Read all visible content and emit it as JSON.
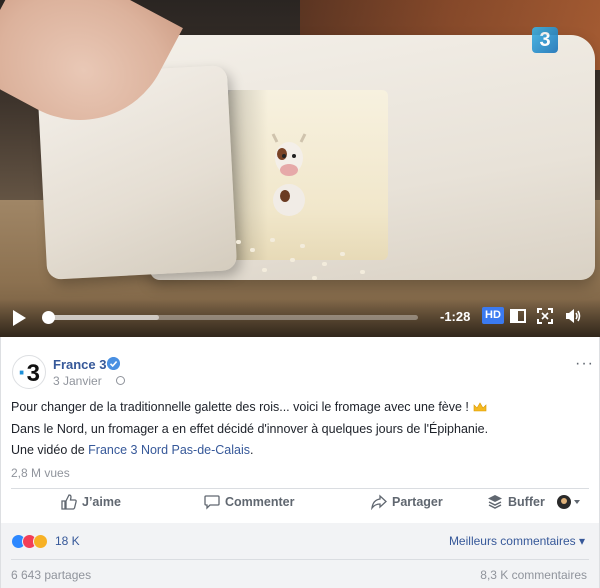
{
  "video": {
    "channel_logo": "3",
    "current_time": "-1:28",
    "hd_label": "HD",
    "progress_fraction": 0.0,
    "buffered_fraction": 0.3,
    "icons": [
      "play-icon",
      "hd-icon",
      "pip-icon",
      "fullscreen-icon",
      "volume-icon"
    ]
  },
  "post": {
    "page_name": "France 3",
    "avatar_text": "3",
    "date": "3 Janvier",
    "more_label": "···",
    "line1": "Pour changer de la traditionnelle galette des rois... voici le fromage avec une fève !",
    "line2": "Dans le Nord, un fromager a en effet décidé d'innover à quelques jours de l'Épiphanie.",
    "line3_prefix": "Une vidéo de ",
    "line3_link": "France 3 Nord Pas-de-Calais",
    "line3_suffix": ".",
    "views": "2,8 M vues"
  },
  "actions": {
    "like": "J’aime",
    "comment": "Commenter",
    "share": "Partager",
    "buffer": "Buffer"
  },
  "reactions": {
    "count": "18 K",
    "best_comments": "Meilleurs commentaires ▾",
    "shares": "6 643 partages",
    "comments": "8,3 K commentaires"
  },
  "colors": {
    "link": "#365899",
    "secondary_text": "#90949c",
    "hd_blue": "#3b7af0",
    "like_blue": "#2d88ff",
    "love_red": "#f33e58",
    "haha_yellow": "#f7b125"
  }
}
